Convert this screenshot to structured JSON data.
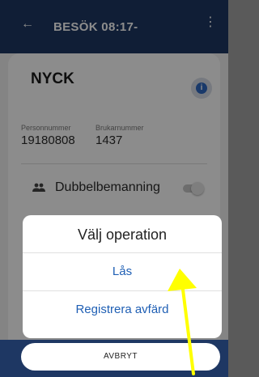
{
  "header": {
    "back_icon": "arrow-left-icon",
    "title": "BESÖK 08:17-",
    "menu_icon": "more-vert-icon"
  },
  "client": {
    "name": "NYCK",
    "personnummer_label": "Personnummer",
    "personnummer": "19180808",
    "brukarnummer_label": "Brukarnummer",
    "brukarnummer": "1437",
    "info_icon_text": "i"
  },
  "dubbel": {
    "label": "Dubbelbemanning",
    "enabled": false
  },
  "sheet": {
    "title": "Välj operation",
    "options": [
      {
        "label": "Lås"
      },
      {
        "label": "Registrera avfärd"
      }
    ]
  },
  "cancel_label": "AVBRYT",
  "colors": {
    "appbar": "#1e3763",
    "link": "#1f5fb4",
    "annotation": "#ffff00"
  }
}
